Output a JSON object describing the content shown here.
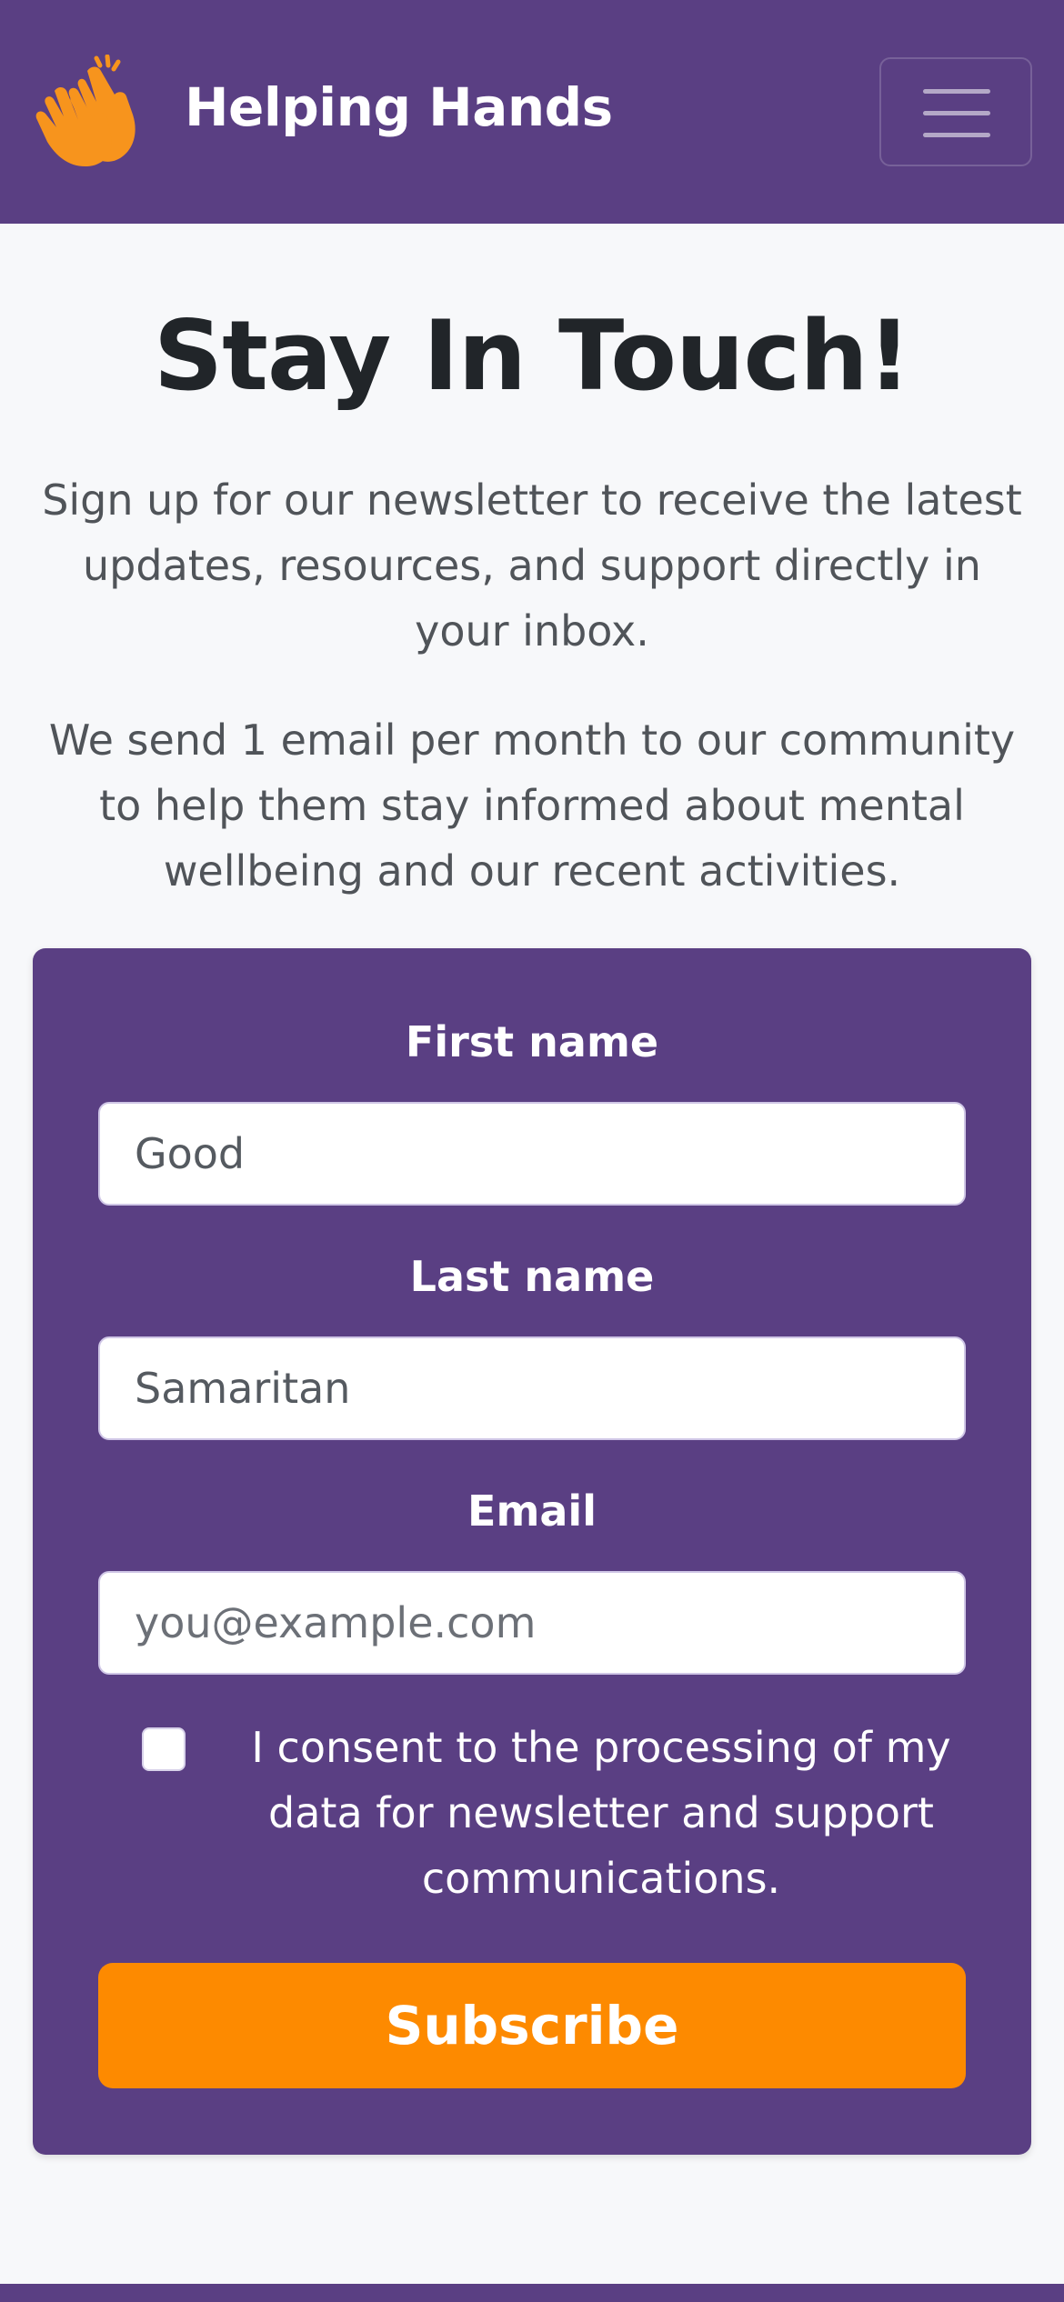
{
  "colors": {
    "brand_purple": "#5a3f83",
    "accent_orange": "#fd8a00",
    "page_background": "#f7f8fa"
  },
  "navbar": {
    "brand_name": "Helping Hands",
    "logo_icon": "clapping-hands-icon",
    "menu_icon": "hamburger-menu-icon"
  },
  "main": {
    "title": "Stay In Touch!",
    "intro_1": "Sign up for our newsletter to receive the latest updates, resources, and support directly in your inbox.",
    "intro_2": "We send 1 email per month to our community to help them stay informed about mental wellbeing and our recent activities."
  },
  "form": {
    "first_name_label": "First name",
    "first_name_value": "Good",
    "last_name_label": "Last name",
    "last_name_value": "Samaritan",
    "email_label": "Email",
    "email_placeholder": "you@example.com",
    "email_value": "",
    "consent_checked": false,
    "consent_text": "I consent to the processing of my data for newsletter and support communications.",
    "subscribe_label": "Subscribe"
  }
}
